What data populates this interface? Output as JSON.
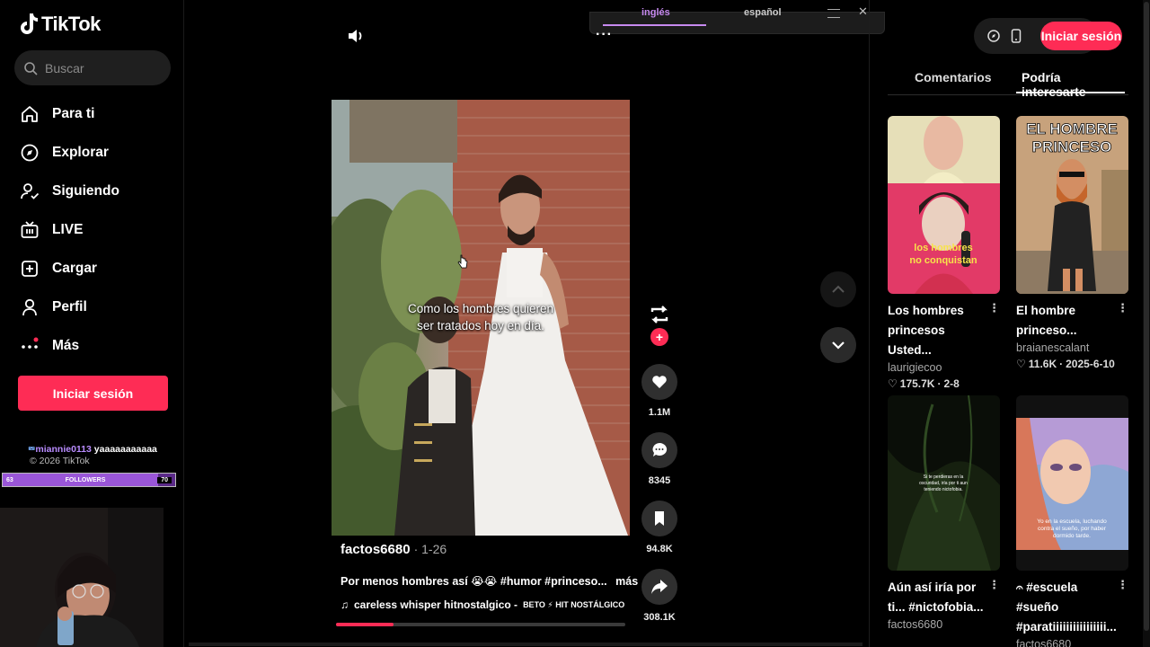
{
  "app": {
    "name": "TikTok"
  },
  "search": {
    "placeholder": "Buscar"
  },
  "nav": {
    "items": [
      {
        "label": "Para ti",
        "icon": "home-icon"
      },
      {
        "label": "Explorar",
        "icon": "compass-icon"
      },
      {
        "label": "Siguiendo",
        "icon": "following-icon"
      },
      {
        "label": "LIVE",
        "icon": "live-tv-icon"
      },
      {
        "label": "Cargar",
        "icon": "upload-plus-icon"
      },
      {
        "label": "Perfil",
        "icon": "profile-icon"
      },
      {
        "label": "Más",
        "icon": "more-dots-icon"
      }
    ]
  },
  "sidebar_login": "Iniciar sesión",
  "stream_overlay": {
    "username": "miannie0113",
    "message": "yaaaaaaaaaaa",
    "copyright": "© 2026 TikTok",
    "followers_label": "FOLLOWERS",
    "followers_current": "63",
    "followers_goal": "70",
    "followers_progress": 0.9
  },
  "language_bar": {
    "tab1": "inglés",
    "tab2": "español"
  },
  "video": {
    "caption_line1": "Como los hombres quieren",
    "caption_line2": "ser tratados hoy en día.",
    "author": "factos6680",
    "date": "· 1-26",
    "description": "Por menos hombres así 😭😭 #humor #princeso...",
    "more_label": "más",
    "music_title": "careless whisper hitnostalgico -",
    "music_artist": "BETO ⚡ HIT NOSTÁLGICO",
    "progress": 0.2
  },
  "actions": {
    "likes": "1.1M",
    "comments": "8345",
    "saves": "94.8K",
    "shares": "308.1K"
  },
  "header": {
    "login": "Iniciar sesión"
  },
  "panel": {
    "tabs": [
      "Comentarios",
      "Podría interesarte"
    ],
    "active_tab": "Podría interesarte",
    "cards": [
      {
        "title": "Los hombres princesos Usted...",
        "user": "laurigiecoo",
        "likes": "175.7K",
        "date": "2-8",
        "overlay_text": "los hombres no conquistan"
      },
      {
        "title": "El hombre princeso...",
        "user": "braianescalant",
        "likes": "11.6K",
        "date": "2025-6-10",
        "overlay_text": "EL HOMBRE PRINCESO"
      },
      {
        "title": "Aún así iría por ti... #nictofobia...",
        "user": "factos6680",
        "overlay_text": "Si te perdieras en la oscuridad, iría por ti aun teniendo nictofobia."
      },
      {
        "title": "𝄐 #escuela #sueño #paratiiiiiiiiiiiiiiii...",
        "user": "factos6680",
        "overlay_text": "Yo en la escuela, luchando contra el sueño, por haber dormido tarde."
      }
    ]
  },
  "colors": {
    "accent": "#fe2c55",
    "background": "#000000",
    "panel": "#1c1c1c"
  }
}
